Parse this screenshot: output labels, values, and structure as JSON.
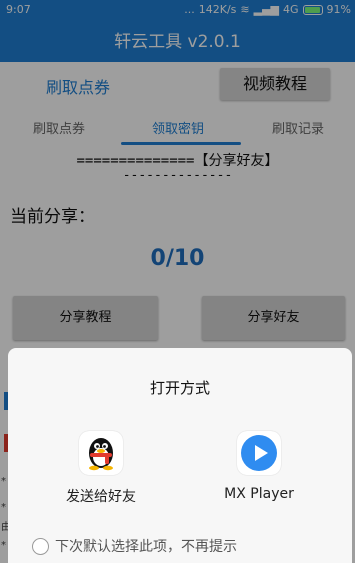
{
  "status_bar": {
    "time": "9:07",
    "dots": "...",
    "net_speed": "142K/s",
    "network": "4G",
    "battery": "91%"
  },
  "app_bar": {
    "title": "轩云工具 v2.0.1"
  },
  "top_actions": {
    "link_label": "刷取点券",
    "video_button_label": "视频教程"
  },
  "tabs": [
    {
      "label": "刷取点券",
      "active": false
    },
    {
      "label": "领取密钥",
      "active": true
    },
    {
      "label": "刷取记录",
      "active": false
    }
  ],
  "share": {
    "title": "==============【分享好友】",
    "divider": "--------------",
    "current_label": "当前分享：",
    "progress": "0/10",
    "tutorial_button": "分享教程",
    "share_button": "分享好友"
  },
  "background_edge_text": [
    "*",
    "*",
    "由",
    "*"
  ],
  "dialog": {
    "title": "打开方式",
    "apps": [
      {
        "label": "发送给好友",
        "icon": "qq-penguin-icon"
      },
      {
        "label": "MX Player",
        "icon": "mx-player-play-icon"
      }
    ],
    "remember_label": "下次默认选择此项，不再提示"
  },
  "colors": {
    "primary": "#1f7fd3",
    "accent_red": "#e23b2e",
    "mx_blue": "#2f8cf0"
  }
}
